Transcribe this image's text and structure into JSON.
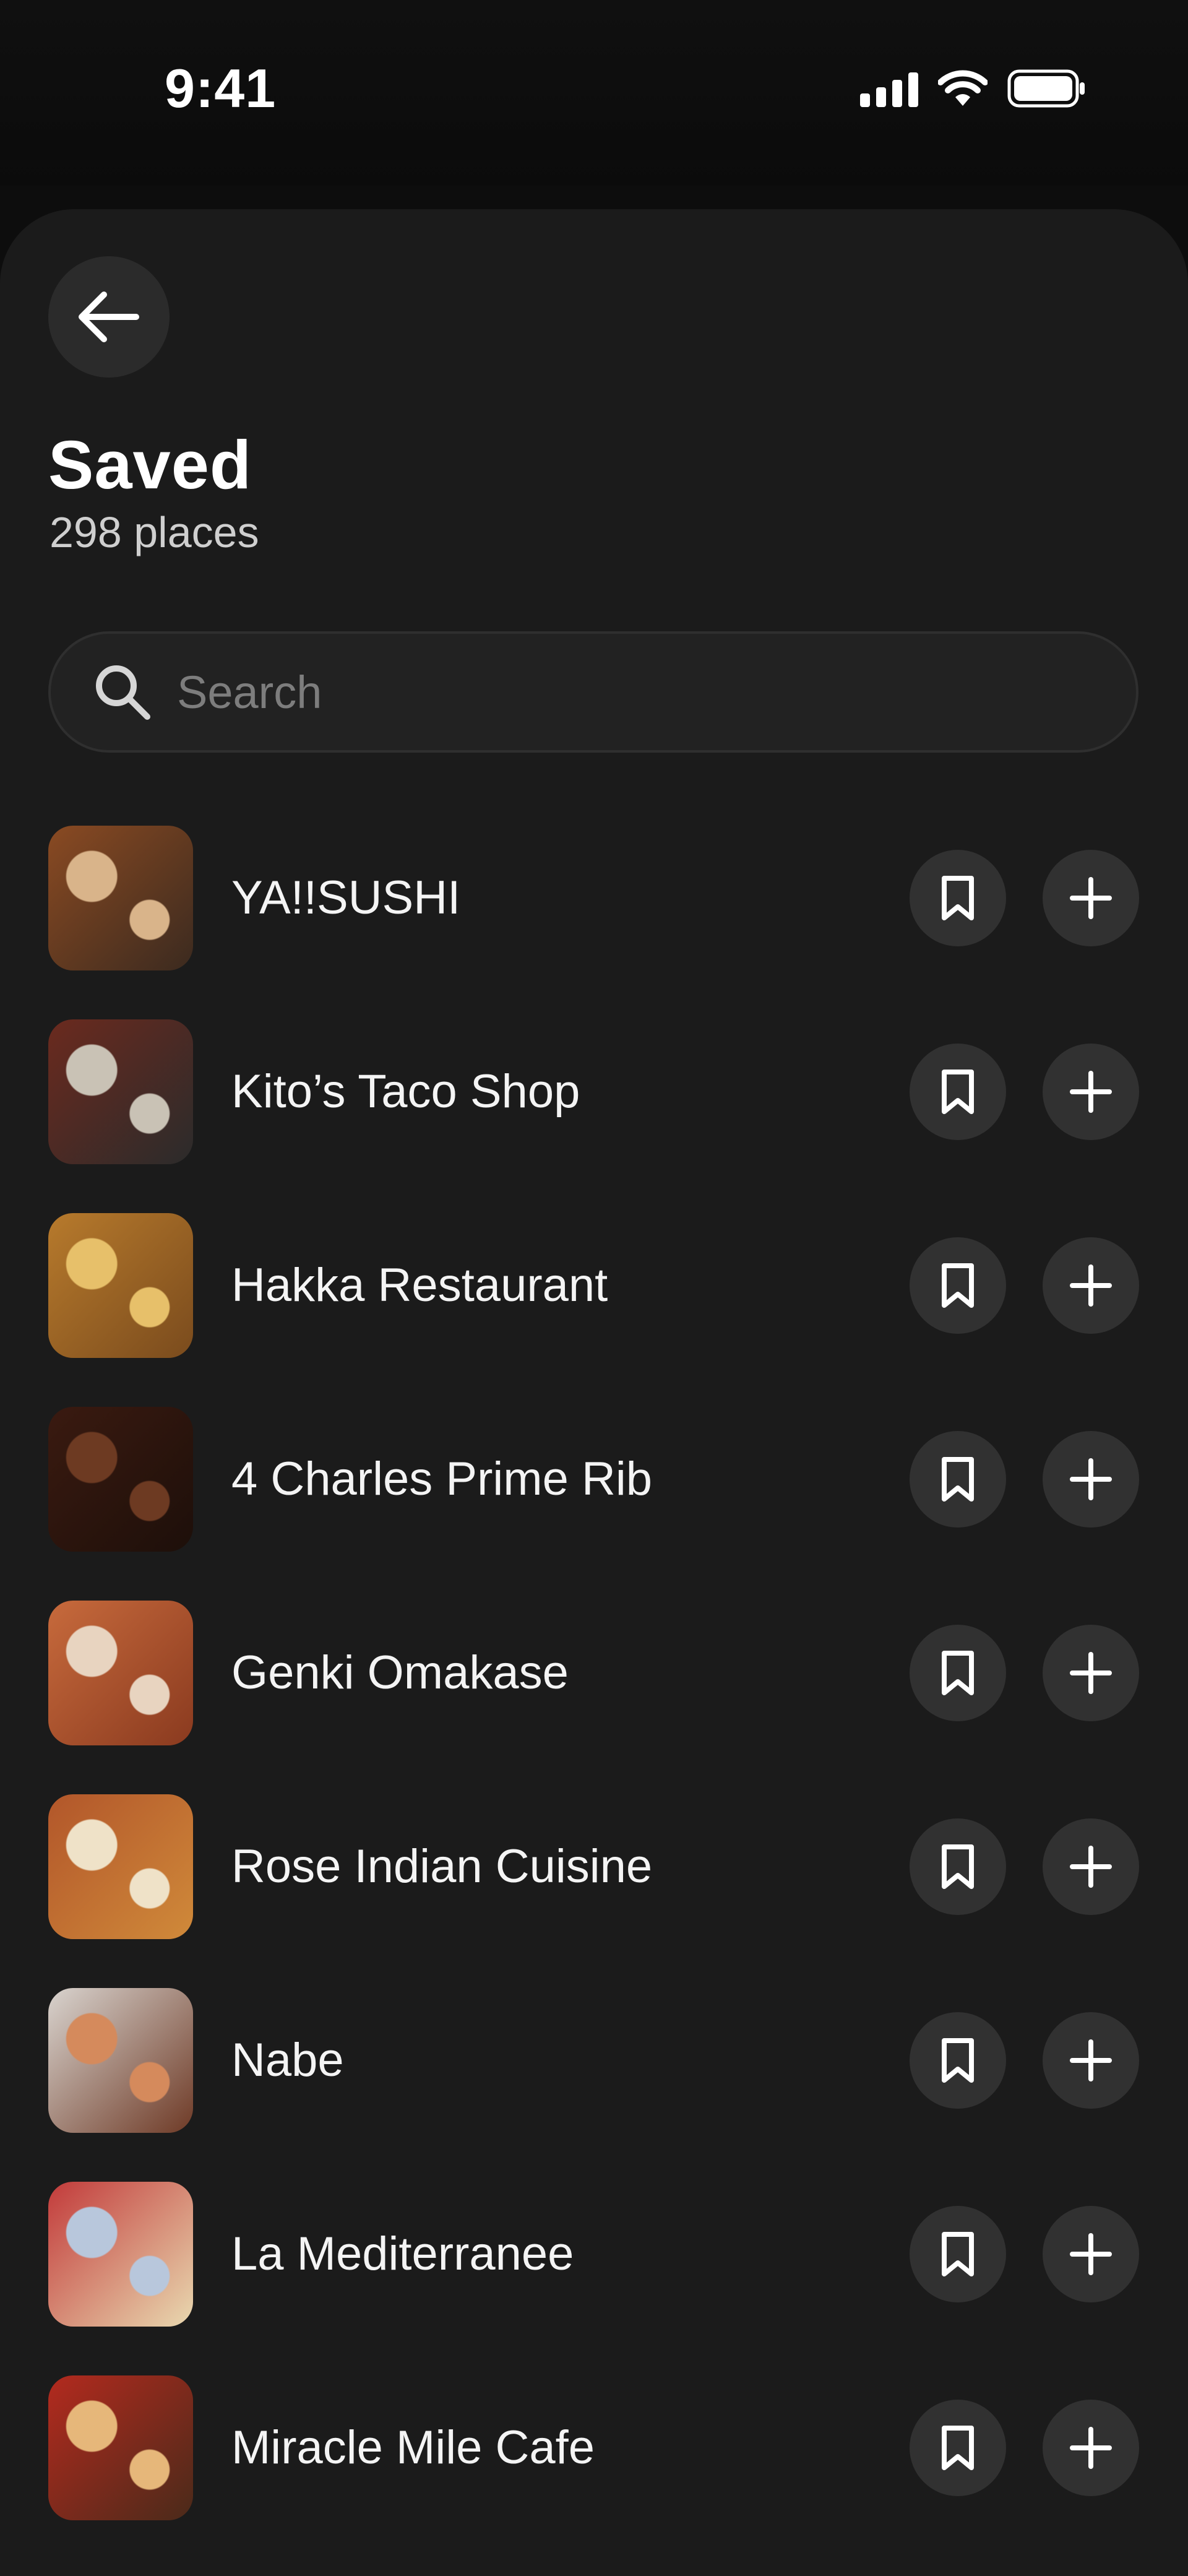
{
  "status_bar": {
    "time": "9:41"
  },
  "header": {
    "back_icon": "arrow-left-icon",
    "title": "Saved",
    "subtitle": "298 places"
  },
  "search": {
    "placeholder": "Search",
    "value": "",
    "icon": "search-icon"
  },
  "places": [
    {
      "name": "YA!!SUSHI",
      "thumb_colors": [
        "#8a4a22",
        "#d9b48a",
        "#3b2a1f"
      ]
    },
    {
      "name": "Kito’s Taco Shop",
      "thumb_colors": [
        "#6b2a1e",
        "#c9c2b5",
        "#2b2b2b"
      ]
    },
    {
      "name": "Hakka Restaurant",
      "thumb_colors": [
        "#b77a2c",
        "#e7c06a",
        "#7a4b1d"
      ]
    },
    {
      "name": "4 Charles Prime Rib",
      "thumb_colors": [
        "#3a1a10",
        "#6d3a22",
        "#1d0f0a"
      ]
    },
    {
      "name": "Genki Omakase",
      "thumb_colors": [
        "#c76a3c",
        "#e8d4c0",
        "#8a3a1f"
      ]
    },
    {
      "name": "Rose Indian Cuisine",
      "thumb_colors": [
        "#b2562a",
        "#efe2c8",
        "#d08a3a"
      ]
    },
    {
      "name": "Nabe",
      "thumb_colors": [
        "#d9d4cf",
        "#d58a5c",
        "#6e3a26"
      ]
    },
    {
      "name": "La Mediterranee",
      "thumb_colors": [
        "#c23a3a",
        "#b8c7dc",
        "#e9d9b0"
      ]
    },
    {
      "name": "Miracle Mile Cafe",
      "thumb_colors": [
        "#b32a1e",
        "#e6b77a",
        "#4a2a1a"
      ]
    }
  ],
  "row_actions": {
    "save_icon": "bookmark-icon",
    "add_icon": "plus-icon"
  },
  "colors": {
    "background": "#0d0d0d",
    "sheet": "#1b1b1b",
    "button": "#313131"
  }
}
